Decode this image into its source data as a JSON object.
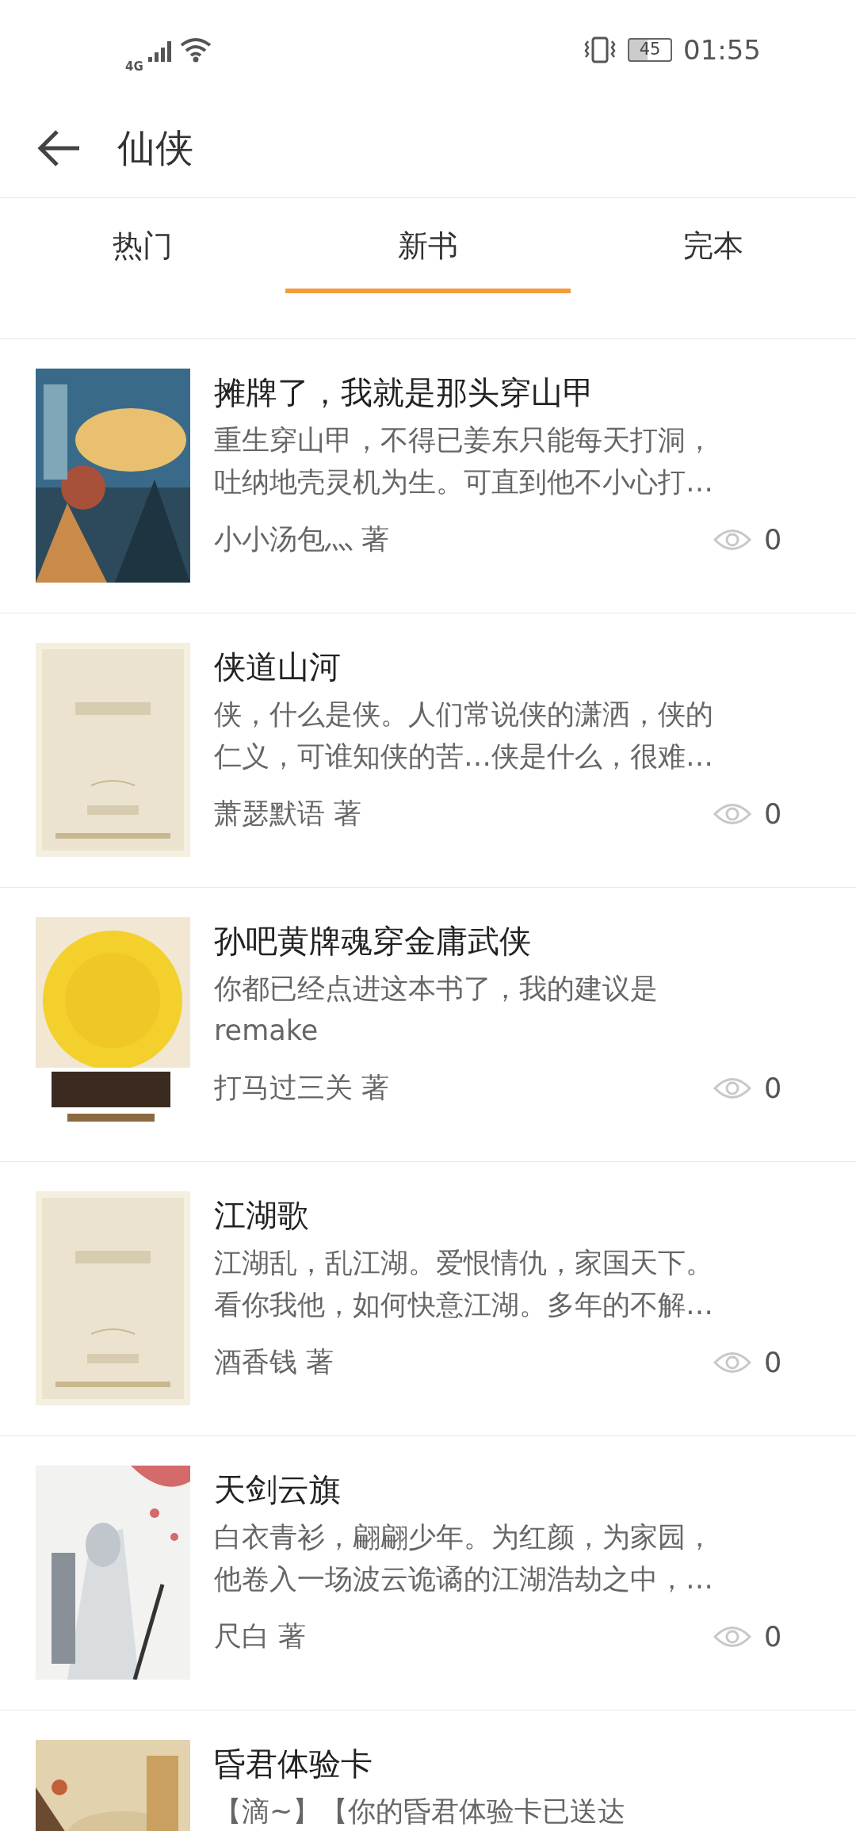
{
  "status_bar": {
    "network": "4G",
    "battery": "45",
    "time": "01:55"
  },
  "header": {
    "title": "仙侠"
  },
  "tabs": [
    {
      "label": "热门",
      "selected": false
    },
    {
      "label": "新书",
      "selected": true
    },
    {
      "label": "完本",
      "selected": false
    }
  ],
  "books": [
    {
      "title": "摊牌了，我就是那头穿山甲",
      "description": "重生穿山甲，不得已姜东只能每天打洞，吐纳地壳灵机为生。可直到他不小心打…",
      "author": "小小汤包灬 著",
      "views": "0"
    },
    {
      "title": "侠道山河",
      "description": "侠，什么是侠。人们常说侠的潇洒，侠的仁义，可谁知侠的苦…侠是什么，很难…",
      "author": "萧瑟默语 著",
      "views": "0"
    },
    {
      "title": "孙吧黄牌魂穿金庸武侠",
      "description": "你都已经点进这本书了，我的建议是remake",
      "author": "打马过三关 著",
      "views": "0"
    },
    {
      "title": "江湖歌",
      "description": "江湖乱，乱江湖。爱恨情仇，家国天下。看你我他，如何快意江湖。多年的不解…",
      "author": "酒香钱 著",
      "views": "0"
    },
    {
      "title": "天剑云旗",
      "description": "白衣青衫，翩翩少年。为红颜，为家园，他卷入一场波云诡谲的江湖浩劫之中，…",
      "author": "尺白 著",
      "views": "0"
    },
    {
      "title": "昏君体验卡",
      "description": "【滴~】【你的昏君体验卡已送达"
    }
  ]
}
